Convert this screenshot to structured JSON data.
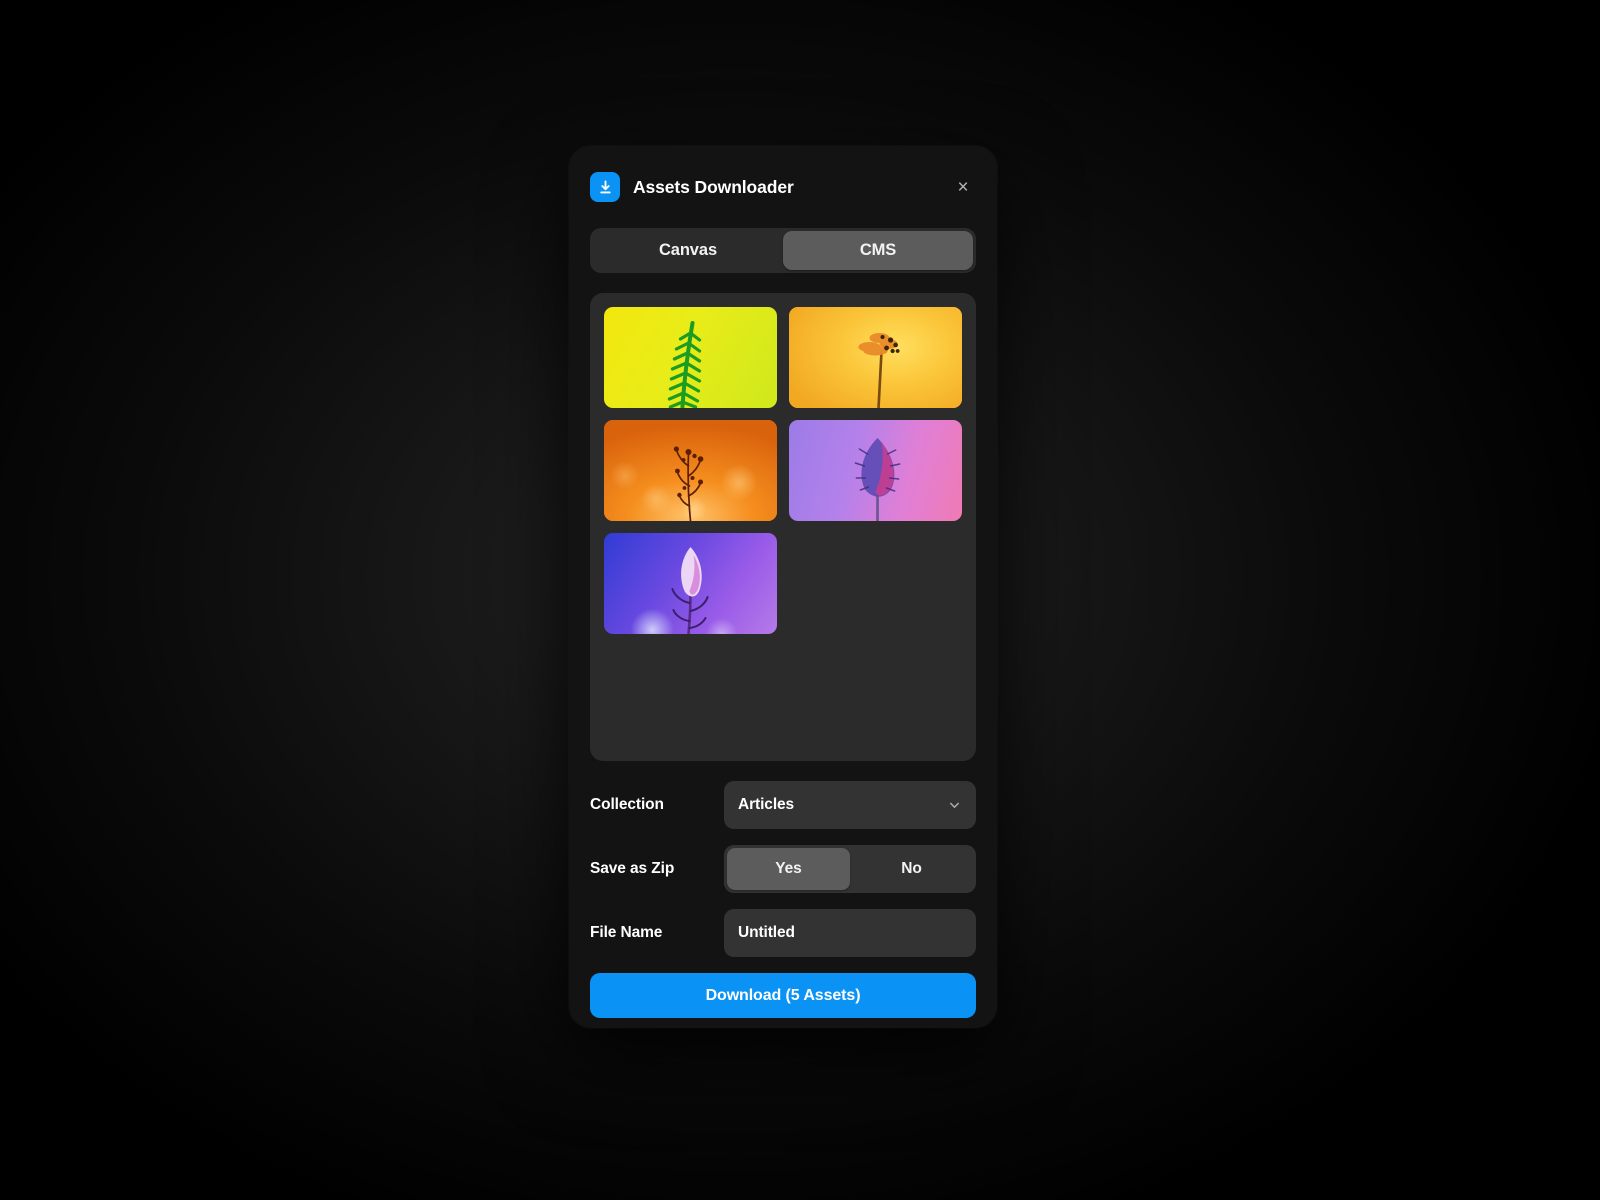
{
  "header": {
    "app_icon": "download-icon",
    "title": "Assets Downloader",
    "close_label": "×"
  },
  "tabs": [
    {
      "label": "Canvas",
      "active": false
    },
    {
      "label": "CMS",
      "active": true
    }
  ],
  "assets": [
    {
      "name": "fern-leaf-yellow",
      "alt": "Green fern frond on yellow background"
    },
    {
      "name": "golden-flower-spike",
      "alt": "Backlit flower spike on golden background"
    },
    {
      "name": "orange-bokeh-plant",
      "alt": "Silhouetted plant on orange bokeh background"
    },
    {
      "name": "purple-allium-bloom",
      "alt": "Spiky allium flower on purple magenta background"
    },
    {
      "name": "violet-lupine-bloom",
      "alt": "Pink lupine flower on blue violet background"
    }
  ],
  "form": {
    "collection": {
      "label": "Collection",
      "value": "Articles",
      "chevron": "chevron-down-icon"
    },
    "save_as_zip": {
      "label": "Save as Zip",
      "options": [
        "Yes",
        "No"
      ],
      "selected": "Yes"
    },
    "file_name": {
      "label": "File Name",
      "value": "Untitled",
      "placeholder": "Untitled"
    }
  },
  "footer": {
    "download_label": "Download  (5 Assets)"
  },
  "colors": {
    "accent": "#0a93f5",
    "modal_bg": "#131313",
    "panel_bg": "#2b2b2b",
    "field_bg": "#333333",
    "pill_active": "#5c5c5c",
    "text": "#ffffff"
  }
}
